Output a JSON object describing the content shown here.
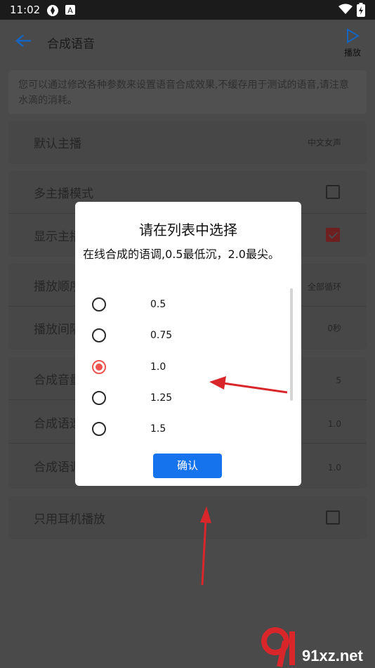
{
  "status_bar": {
    "time": "11:02"
  },
  "app_bar": {
    "title": "合成语音",
    "play_label": "播放"
  },
  "description": "您可以通过修改各种参数来设置语音合成效果,不缓存用于测试的语音,请注意水滴的消耗。",
  "settings": {
    "default_anchor": {
      "label": "默认主播",
      "value": "中文女声"
    },
    "multi_anchor": {
      "label": "多主播模式",
      "checked": false
    },
    "show_anchor": {
      "label": "显示主播",
      "checked": true
    },
    "play_order": {
      "label": "播放顺序",
      "value": "全部循环"
    },
    "play_interval": {
      "label": "播放间隔",
      "value": "0秒"
    },
    "synth_volume": {
      "label": "合成音量",
      "value": "5"
    },
    "synth_speed": {
      "label": "合成语速",
      "value": "1.0"
    },
    "synth_pitch": {
      "label": "合成语调",
      "value": "1.0"
    },
    "headphone_only": {
      "label": "只用耳机播放",
      "checked": false
    }
  },
  "dialog": {
    "title": "请在列表中选择",
    "message": "在线合成的语调,0.5最低沉，2.0最尖。",
    "options": [
      {
        "label": "0.5",
        "selected": false
      },
      {
        "label": "0.75",
        "selected": false
      },
      {
        "label": "1.0",
        "selected": true
      },
      {
        "label": "1.25",
        "selected": false
      },
      {
        "label": "1.5",
        "selected": false
      }
    ],
    "confirm_label": "确认"
  },
  "watermark": {
    "text": "91xz.net"
  },
  "colors": {
    "accent_blue": "#1673ee",
    "radio_selected": "#ef5350",
    "annotation_arrow": "#d9262b"
  }
}
